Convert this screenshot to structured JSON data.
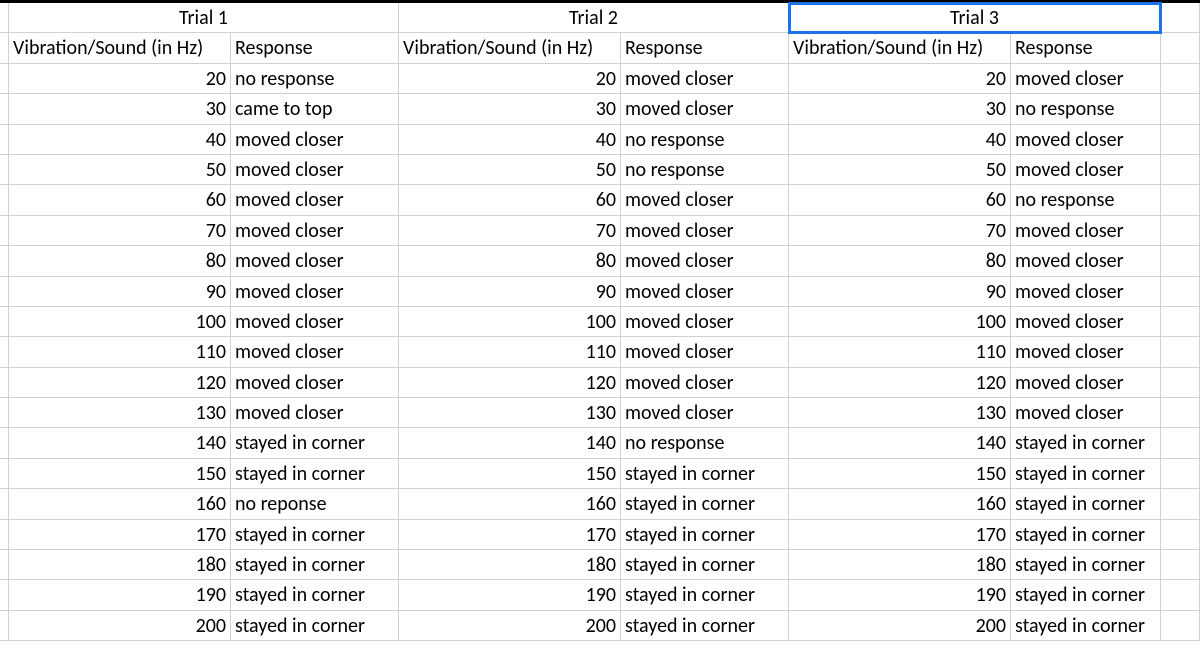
{
  "trials": [
    {
      "title": "Trial 1",
      "hz_header": "Vibration/Sound (in Hz)",
      "resp_header": "Response"
    },
    {
      "title": "Trial 2",
      "hz_header": "Vibration/Sound (in Hz)",
      "resp_header": "Response"
    },
    {
      "title": "Trial 3",
      "hz_header": "Vibration/Sound (in Hz)",
      "resp_header": "Response"
    }
  ],
  "selected_cell": "trial-3-title",
  "rows": [
    {
      "hz": 20,
      "r1": "no response",
      "r2": "moved closer",
      "r3": "moved closer"
    },
    {
      "hz": 30,
      "r1": "came to top",
      "r2": "moved closer",
      "r3": "no response"
    },
    {
      "hz": 40,
      "r1": "moved closer",
      "r2": "no response",
      "r3": "moved closer"
    },
    {
      "hz": 50,
      "r1": "moved closer",
      "r2": "no response",
      "r3": "moved closer"
    },
    {
      "hz": 60,
      "r1": "moved closer",
      "r2": "moved closer",
      "r3": "no response"
    },
    {
      "hz": 70,
      "r1": "moved closer",
      "r2": "moved closer",
      "r3": "moved closer"
    },
    {
      "hz": 80,
      "r1": "moved closer",
      "r2": "moved closer",
      "r3": "moved closer"
    },
    {
      "hz": 90,
      "r1": "moved closer",
      "r2": "moved closer",
      "r3": "moved closer"
    },
    {
      "hz": 100,
      "r1": "moved closer",
      "r2": "moved closer",
      "r3": "moved closer"
    },
    {
      "hz": 110,
      "r1": "moved closer",
      "r2": "moved closer",
      "r3": "moved closer"
    },
    {
      "hz": 120,
      "r1": "moved closer",
      "r2": "moved closer",
      "r3": "moved closer"
    },
    {
      "hz": 130,
      "r1": "moved closer",
      "r2": "moved closer",
      "r3": "moved closer"
    },
    {
      "hz": 140,
      "r1": "stayed in corner",
      "r2": "no response",
      "r3": "stayed in corner"
    },
    {
      "hz": 150,
      "r1": "stayed in corner",
      "r2": "stayed in corner",
      "r3": "stayed in corner"
    },
    {
      "hz": 160,
      "r1": "no reponse",
      "r2": "stayed in corner",
      "r3": "stayed in corner"
    },
    {
      "hz": 170,
      "r1": "stayed in corner",
      "r2": "stayed in corner",
      "r3": "stayed in corner"
    },
    {
      "hz": 180,
      "r1": "stayed in corner",
      "r2": "stayed in corner",
      "r3": "stayed in corner"
    },
    {
      "hz": 190,
      "r1": "stayed in corner",
      "r2": "stayed in corner",
      "r3": "stayed in corner"
    },
    {
      "hz": 200,
      "r1": "stayed in corner",
      "r2": "stayed in corner",
      "r3": "stayed in corner"
    }
  ]
}
